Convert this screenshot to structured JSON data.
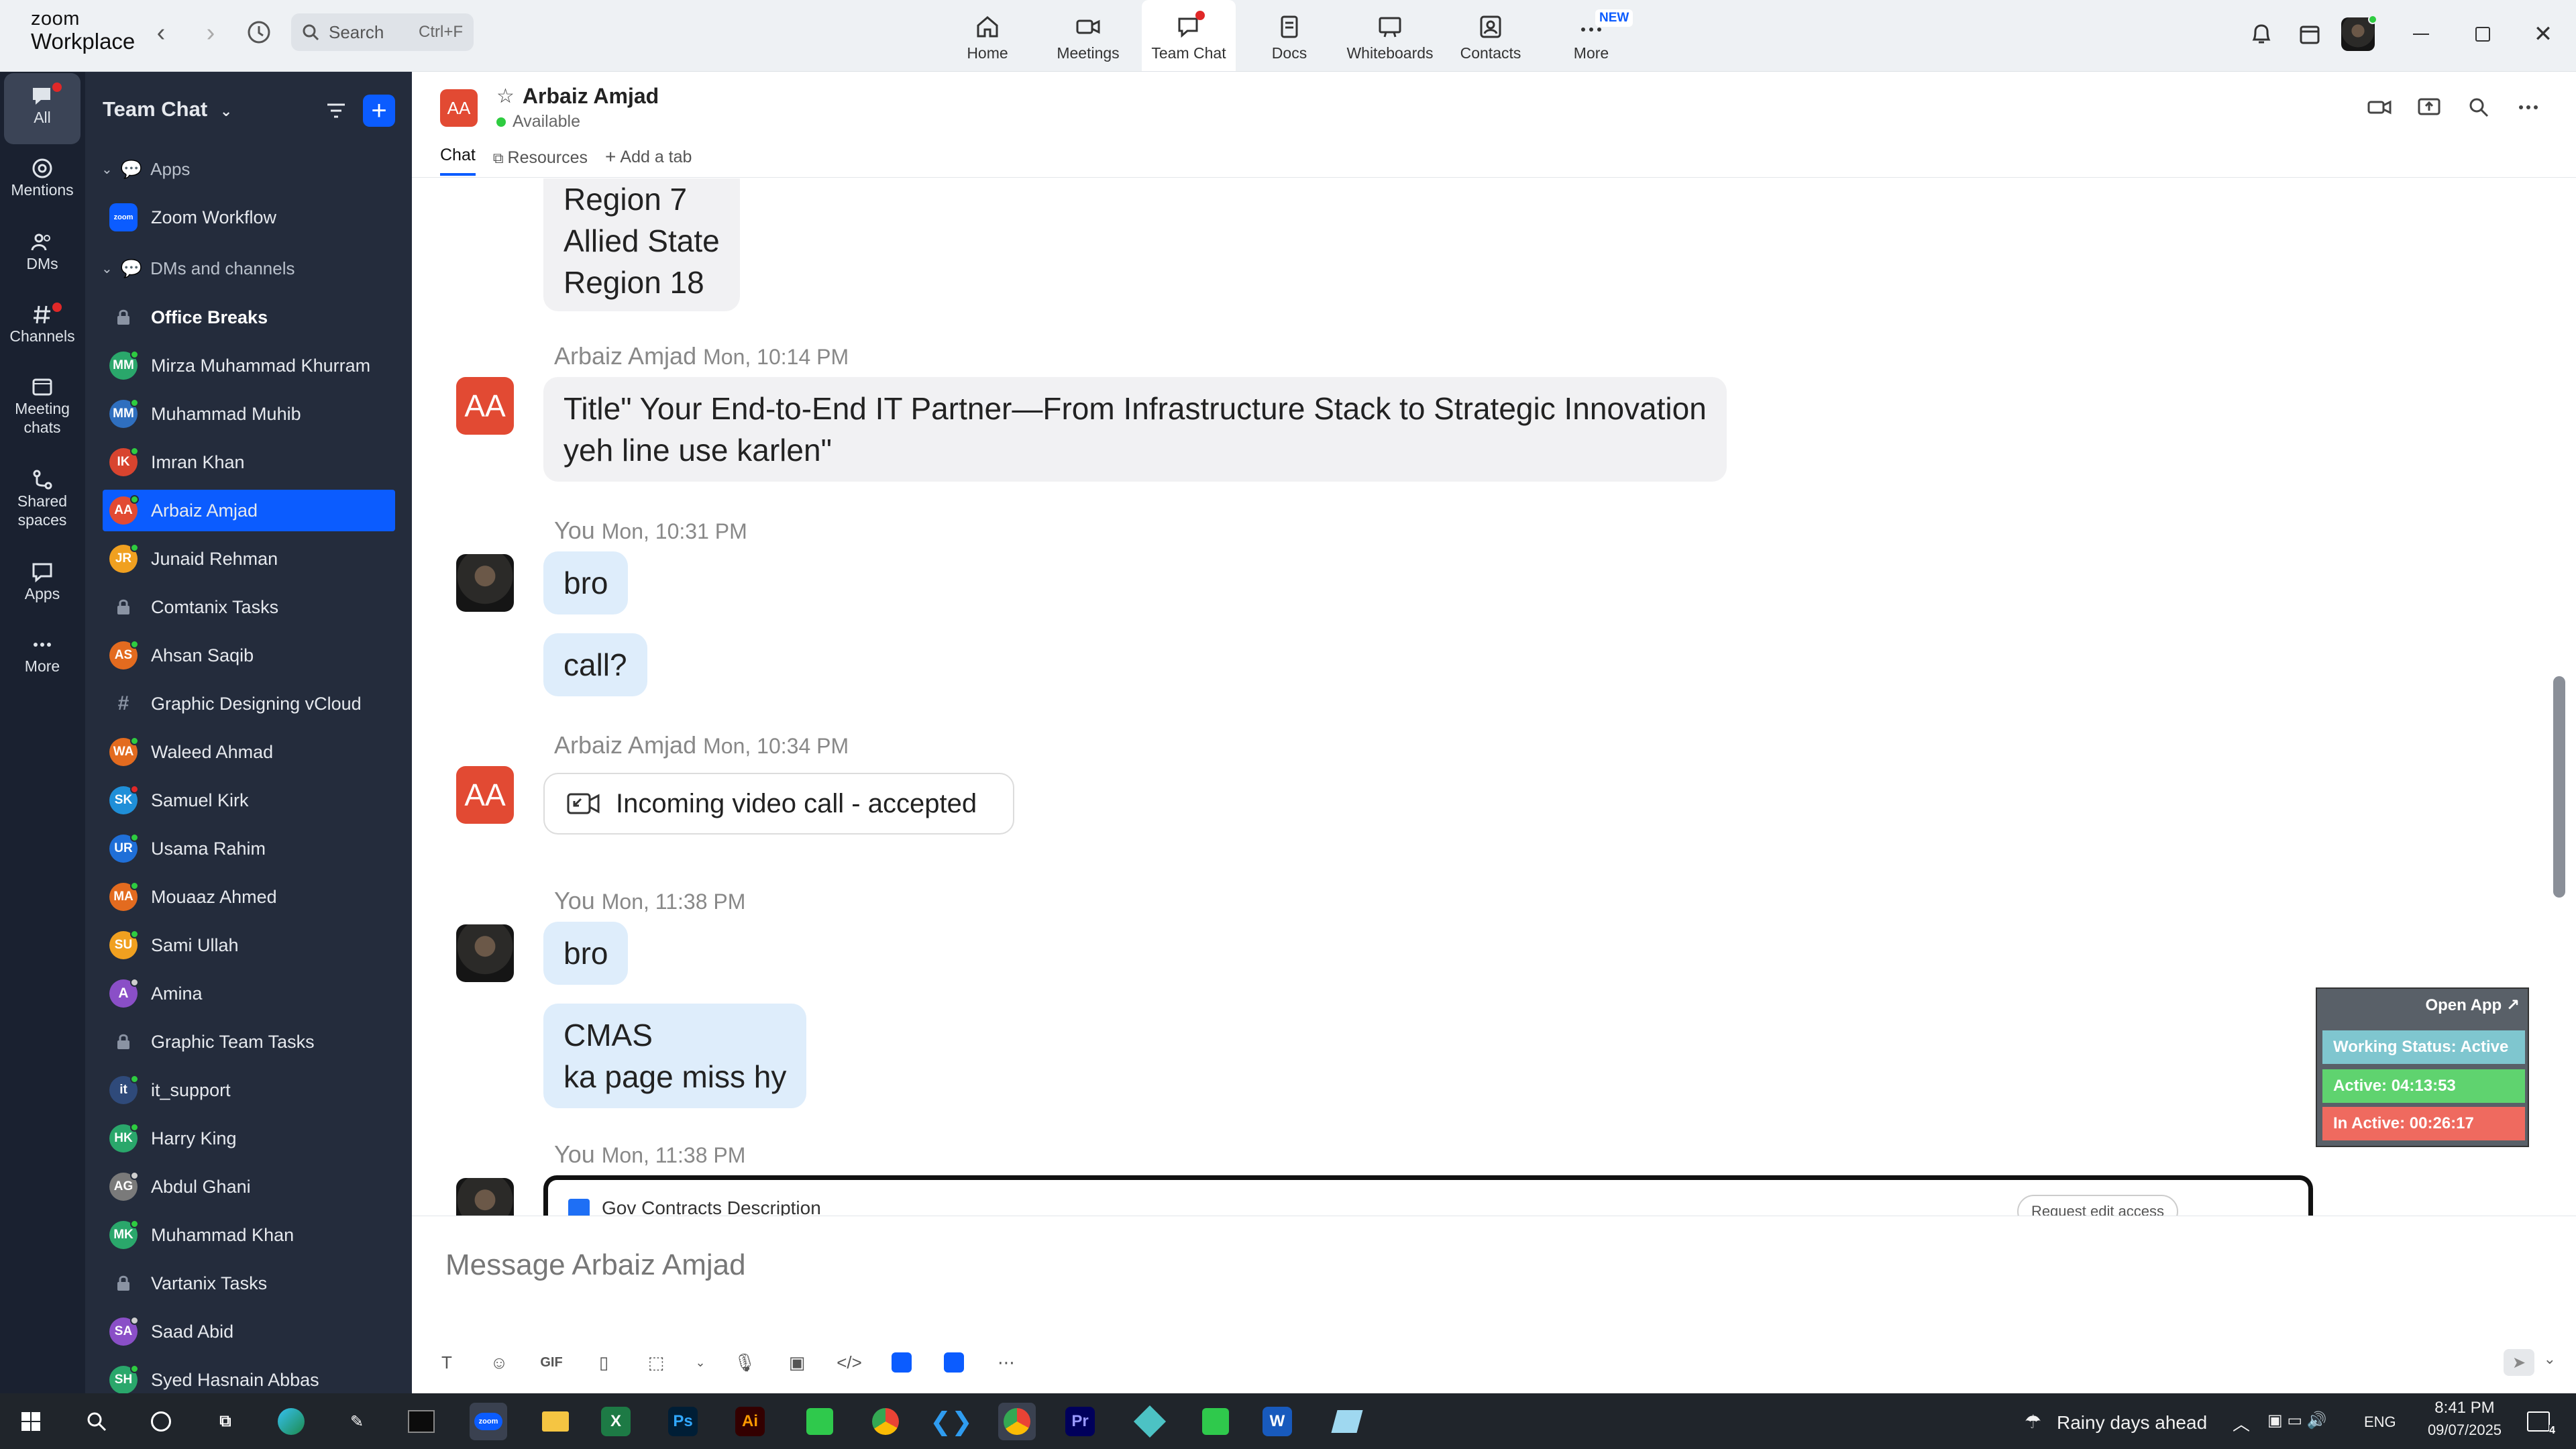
{
  "app": {
    "logo_line1": "zoom",
    "logo_line2": "Workplace",
    "search_placeholder": "Search",
    "search_shortcut": "Ctrl+F"
  },
  "topnav": {
    "home": "Home",
    "meetings": "Meetings",
    "team_chat": "Team Chat",
    "docs": "Docs",
    "whiteboards": "Whiteboards",
    "contacts": "Contacts",
    "more": "More",
    "new_badge": "NEW"
  },
  "rail": {
    "all": "All",
    "mentions": "Mentions",
    "dms": "DMs",
    "channels": "Channels",
    "meeting_chats_1": "Meeting",
    "meeting_chats_2": "chats",
    "shared_spaces_1": "Shared",
    "shared_spaces_2": "spaces",
    "apps": "Apps",
    "more": "More"
  },
  "sidebar": {
    "title": "Team Chat",
    "section_apps": "Apps",
    "section_dms": "DMs and channels",
    "items": [
      {
        "name": "Zoom Workflow",
        "initials": "zoom",
        "color": "#0b5cff",
        "status": "none"
      },
      {
        "name": "Office Breaks",
        "initials": "",
        "color": "#3a4356",
        "status": "none",
        "bold": true,
        "lock": true
      },
      {
        "name": "Mirza Muhammad Khurram",
        "initials": "MM",
        "color": "#2aa76b",
        "status": "online"
      },
      {
        "name": "Muhammad Muhib",
        "initials": "MM",
        "color": "#2f6fbf",
        "status": "online"
      },
      {
        "name": "Imran Khan",
        "initials": "IK",
        "color": "#d8442f",
        "status": "online"
      },
      {
        "name": "Arbaiz Amjad",
        "initials": "AA",
        "color": "#e24a33",
        "status": "online",
        "active": true
      },
      {
        "name": "Junaid Rehman",
        "initials": "JR",
        "color": "#f0a020",
        "status": "online"
      },
      {
        "name": "Comtanix Tasks",
        "initials": "",
        "color": "#3a4356",
        "status": "none",
        "lock": true
      },
      {
        "name": "Ahsan Saqib",
        "initials": "AS",
        "color": "#e36b1f",
        "status": "mobile"
      },
      {
        "name": "Graphic Designing vCloud",
        "initials": "#",
        "color": "#3a4356",
        "status": "none"
      },
      {
        "name": "Waleed Ahmad",
        "initials": "WA",
        "color": "#e36b1f",
        "status": "online"
      },
      {
        "name": "Samuel Kirk",
        "initials": "SK",
        "color": "#1f8fd8",
        "status": "busy"
      },
      {
        "name": "Usama Rahim",
        "initials": "UR",
        "color": "#1f6fd8",
        "status": "online"
      },
      {
        "name": "Mouaaz Ahmed",
        "initials": "MA",
        "color": "#e36b1f",
        "status": "online"
      },
      {
        "name": "Sami Ullah",
        "initials": "SU",
        "color": "#f0a020",
        "status": "online"
      },
      {
        "name": "Amina",
        "initials": "A",
        "color": "#8a4fc7",
        "status": "away"
      },
      {
        "name": "Graphic Team Tasks",
        "initials": "",
        "color": "#3a4356",
        "status": "none",
        "lock": true
      },
      {
        "name": "it_support",
        "initials": "it",
        "color": "#2f4a7a",
        "status": "mobile"
      },
      {
        "name": "Harry King",
        "initials": "HK",
        "color": "#2aa76b",
        "status": "mobile"
      },
      {
        "name": "Abdul Ghani",
        "initials": "AG",
        "color": "#7a7a7a",
        "status": "away"
      },
      {
        "name": "Muhammad Khan",
        "initials": "MK",
        "color": "#2aa76b",
        "status": "online"
      },
      {
        "name": "Vartanix Tasks",
        "initials": "",
        "color": "#3a4356",
        "status": "none",
        "lock": true
      },
      {
        "name": "Saad Abid",
        "initials": "SA",
        "color": "#8a4fc7",
        "status": "away"
      },
      {
        "name": "Syed Hasnain Abbas",
        "initials": "SH",
        "color": "#2aa76b",
        "status": "online"
      }
    ]
  },
  "chat": {
    "contact_initials": "AA",
    "contact_name": "Arbaiz Amjad",
    "contact_status": "Available",
    "tab_chat": "Chat",
    "tab_resources": "Resources",
    "tab_add": "Add a tab",
    "composer_placeholder": "Message Arbaiz Amjad",
    "messages": {
      "partial_lines": [
        "Region 7",
        "Allied State",
        "Region 18"
      ],
      "m1_sender": "Arbaiz Amjad",
      "m1_time": "Mon, 10:14 PM",
      "m1_text_1": "Title\" Your End-to-End IT Partner—From Infrastructure Stack to Strategic Innovation",
      "m1_text_2": "yeh line use karlen\"",
      "m2_sender": "You",
      "m2_time": "Mon, 10:31 PM",
      "m2_text_a": "bro",
      "m2_text_b": "call?",
      "m3_sender": "Arbaiz Amjad",
      "m3_time": "Mon, 10:34 PM",
      "m3_text": "Incoming video call - accepted",
      "m4_sender": "You",
      "m4_time": "Mon, 11:38 PM",
      "m4_text_a": "bro",
      "m4_text_b1": "CMAS",
      "m4_text_b2": "ka page miss hy",
      "m5_sender": "You",
      "m5_time": "Mon, 11:38 PM",
      "doc_title": "Gov Contracts Description",
      "doc_request": "Request edit access"
    }
  },
  "widget": {
    "open_app": "Open App ↗",
    "working": "Working Status: Active",
    "active": "Active: 04:13:53",
    "inactive": "In Active: 00:26:17",
    "colors": {
      "working": "#7fc6cf",
      "active": "#5fd36f",
      "inactive": "#ef6a5f"
    }
  },
  "taskbar": {
    "weather": "Rainy days ahead",
    "lang": "ENG",
    "time": "8:41 PM",
    "date": "09/07/2025",
    "notif_count": "4"
  },
  "colors": {
    "accent": "#0b5cff",
    "rail": "#1a2130",
    "sidebar": "#242c3c",
    "avatar_red": "#e24a33"
  }
}
